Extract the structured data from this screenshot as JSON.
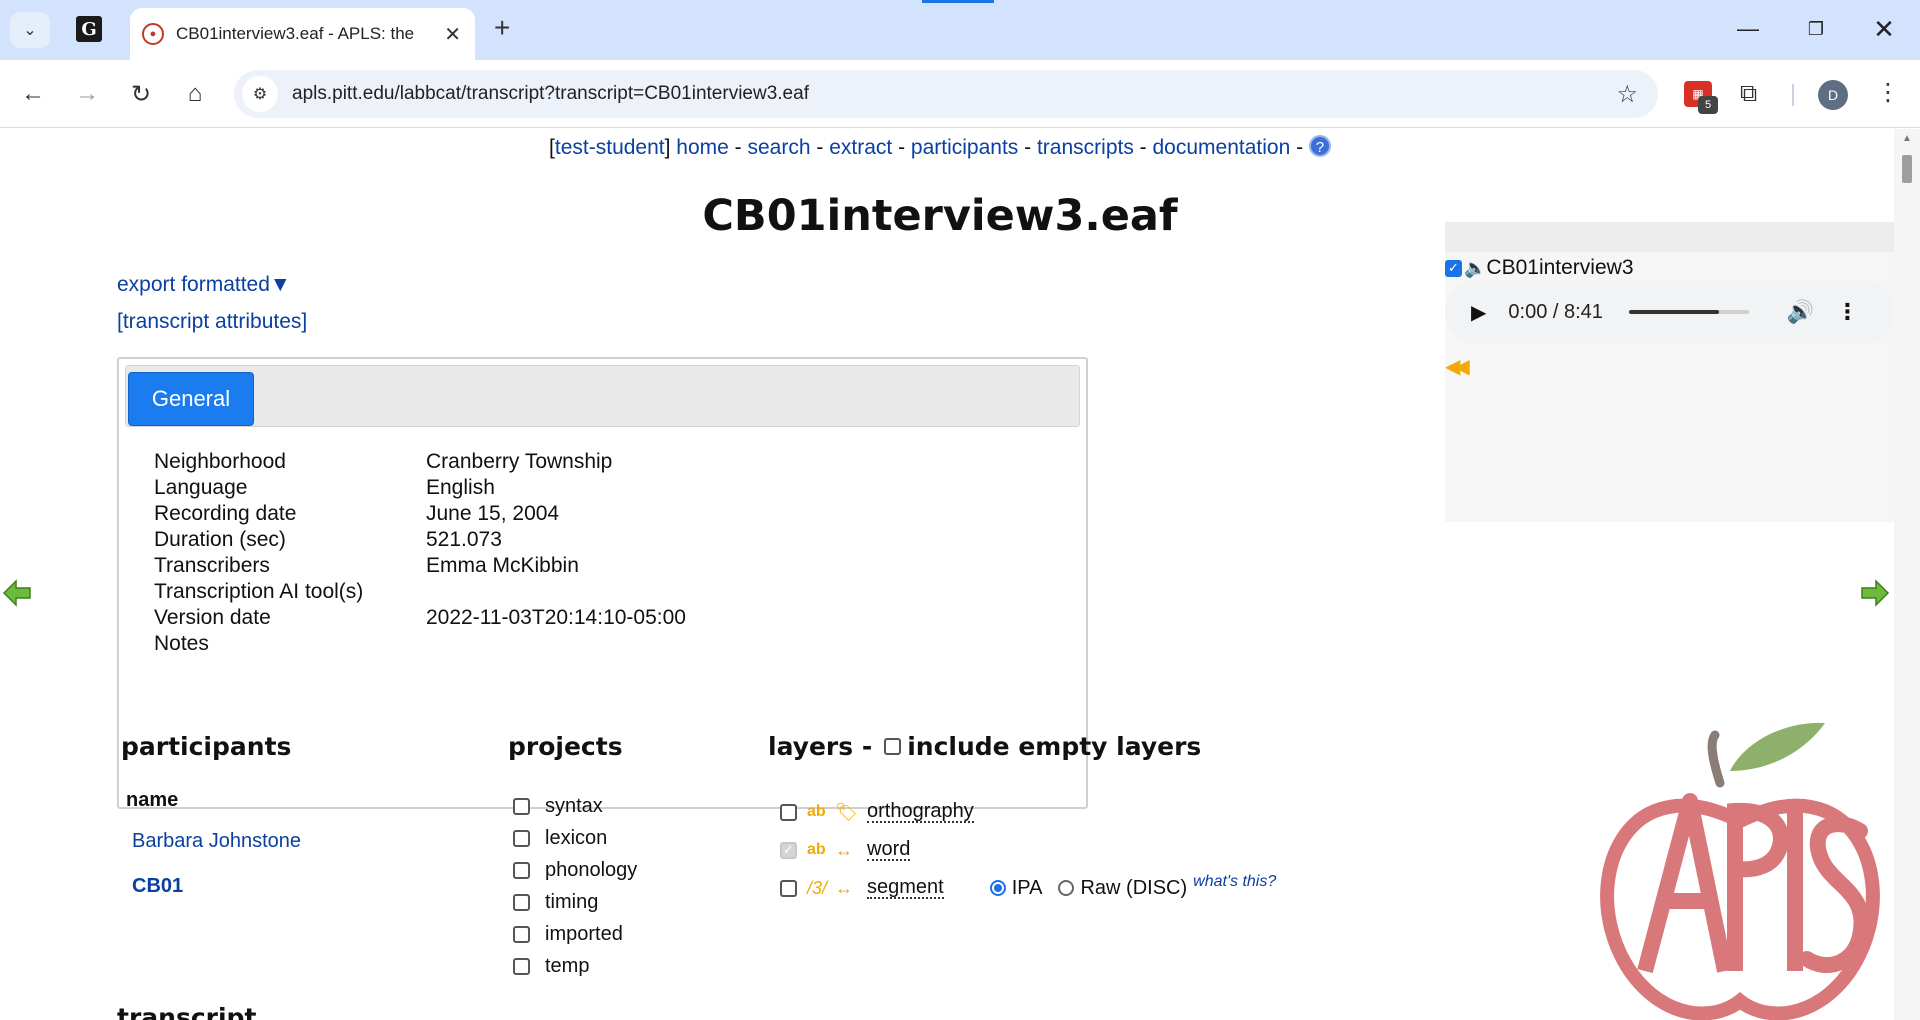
{
  "browser": {
    "tab_title": "CB01interview3.eaf - APLS: the",
    "pinned_tab_letter": "G",
    "url": "apls.pitt.edu/labbcat/transcript?transcript=CB01interview3.eaf",
    "extension_badge_count": "5",
    "avatar_letter": "D"
  },
  "nav": {
    "user": "test-student",
    "links": [
      "home",
      "search",
      "extract",
      "participants",
      "transcripts",
      "documentation"
    ],
    "help": "?"
  },
  "title": "CB01interview3.eaf",
  "export_label": "export formatted▼",
  "attributes_link": "[transcript attributes]",
  "attribute_tab": "General",
  "attributes": [
    {
      "label": "Neighborhood",
      "value": "Cranberry Township"
    },
    {
      "label": "Language",
      "value": "English"
    },
    {
      "label": "Recording date",
      "value": "June 15, 2004"
    },
    {
      "label": "Duration (sec)",
      "value": "521.073"
    },
    {
      "label": "Transcribers",
      "value": "Emma McKibbin"
    },
    {
      "label": "Transcription AI tool(s)",
      "value": ""
    },
    {
      "label": "Version date",
      "value": "2022-11-03T20:14:10-05:00"
    },
    {
      "label": "Notes",
      "value": ""
    }
  ],
  "media": {
    "name": "CB01interview3",
    "time": "0:00 / 8:41",
    "progress": 0.75
  },
  "participants": {
    "heading": "participants",
    "column": "name",
    "name": "Barbara Johnstone",
    "code": "CB01"
  },
  "projects": {
    "heading": "projects",
    "items": [
      "syntax",
      "lexicon",
      "phonology",
      "timing",
      "imported",
      "temp"
    ]
  },
  "layers": {
    "heading": "layers -",
    "include_empty": "include empty layers",
    "items": [
      {
        "type": "ab",
        "name": "orthography"
      },
      {
        "type": "ab",
        "name": "word"
      },
      {
        "type": "/3/",
        "name": "segment"
      }
    ],
    "ipa": "IPA",
    "raw": "Raw (DISC)",
    "whats_this": "what's this?"
  },
  "bottom_heading": "transcript",
  "logo_text": "APLS",
  "colors": {
    "link": "#0b3fa0",
    "tab_active": "#1b7cf0",
    "layer_accent": "#f2a900",
    "logo_red": "#d9787a",
    "logo_leaf": "#8db06b"
  }
}
